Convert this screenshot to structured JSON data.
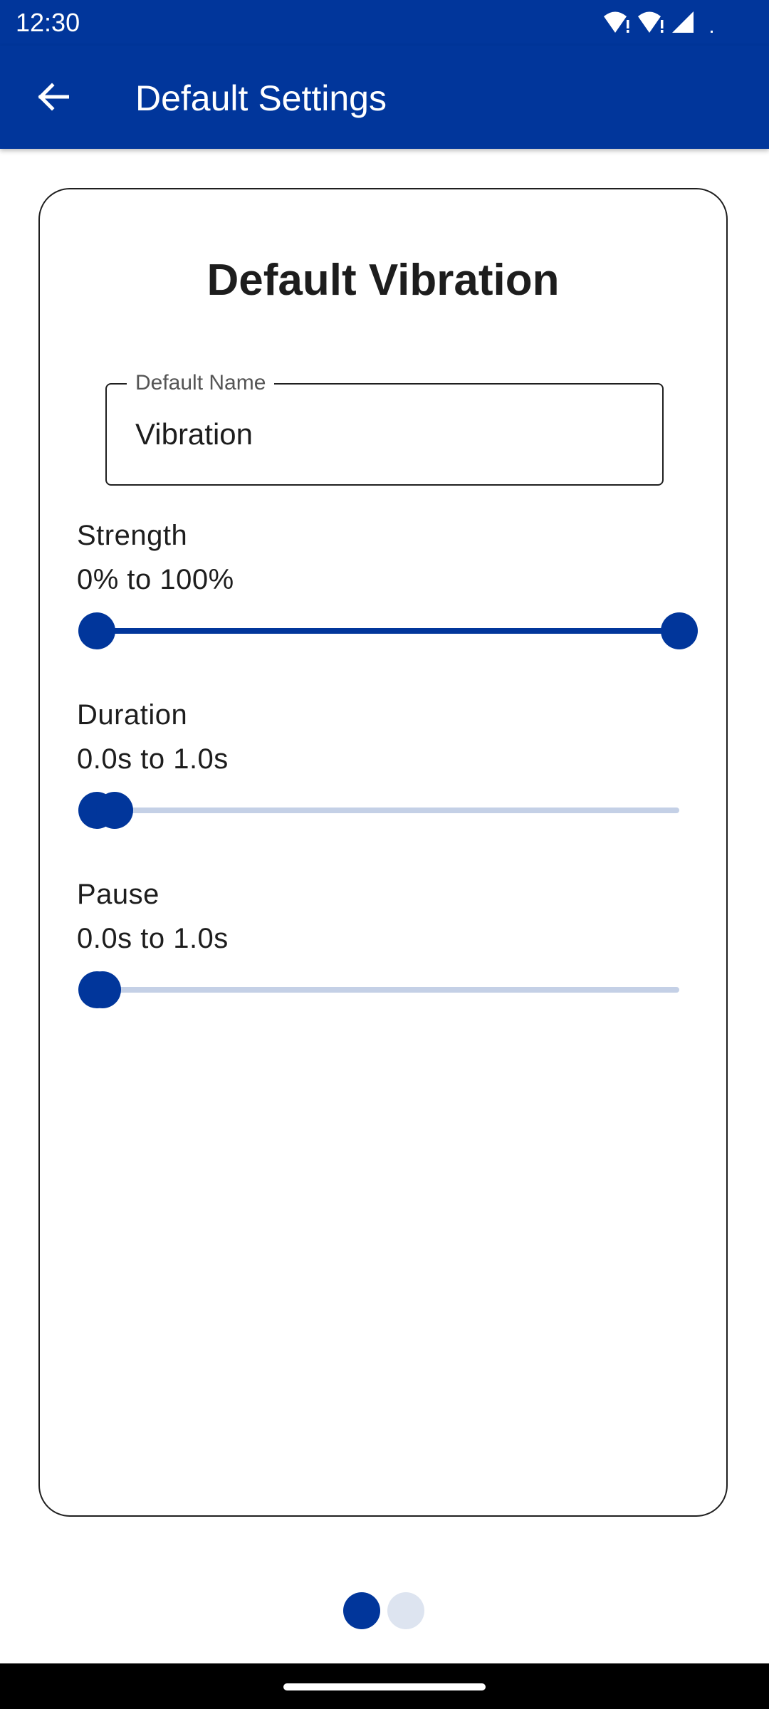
{
  "status_bar": {
    "time": "12:30",
    "icons": [
      "wifi-alert-icon",
      "wifi-alert-icon",
      "cellular-signal-icon",
      "battery-dot-icon"
    ]
  },
  "app_bar": {
    "title": "Default Settings",
    "back_icon": "arrow-back-icon"
  },
  "card": {
    "title": "Default Vibration",
    "name_field": {
      "label": "Default Name",
      "value": "Vibration"
    },
    "sliders": [
      {
        "label": "Strength",
        "range_text": "0% to 100%",
        "min_fraction": 0.0,
        "max_fraction": 1.0
      },
      {
        "label": "Duration",
        "range_text": "0.0s to 1.0s",
        "min_fraction": 0.0,
        "max_fraction": 0.03
      },
      {
        "label": "Pause",
        "range_text": "0.0s to 1.0s",
        "min_fraction": 0.0,
        "max_fraction": 0.01
      }
    ]
  },
  "page_indicator": {
    "total_pages": 2,
    "current_page": 1
  },
  "colors": {
    "primary": "#01369b",
    "track_inactive": "#c4d0e6",
    "dot_inactive": "#dde4f0"
  }
}
